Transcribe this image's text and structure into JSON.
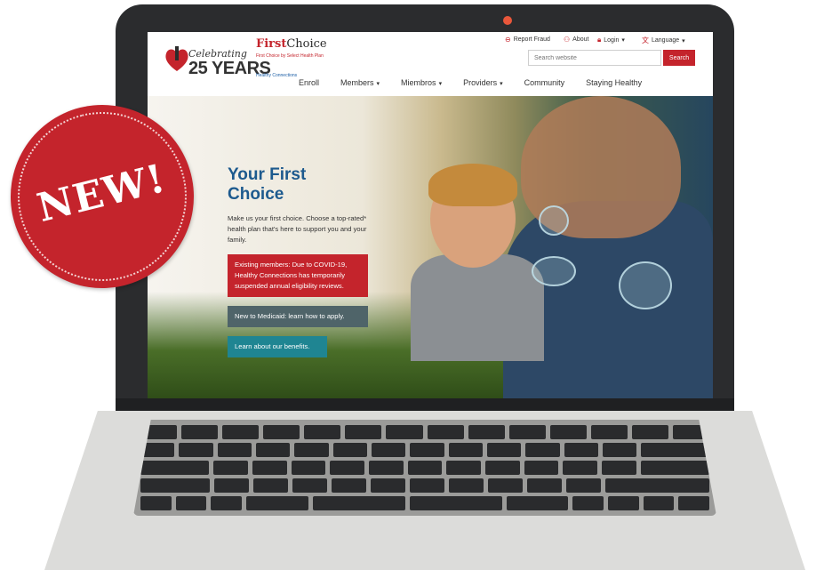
{
  "badge": {
    "text": "NEW!"
  },
  "site": {
    "logo": {
      "celebrating": "Celebrating",
      "years": "25 YEARS",
      "brand_first": "First",
      "brand_choice": "Choice",
      "brand_tagline": "First Choice by Select Health Plan",
      "partner": "Healthy Connections"
    },
    "utility": {
      "report_fraud": "Report Fraud",
      "about": "About",
      "login": "Login",
      "language": "Language"
    },
    "search": {
      "placeholder": "Search website",
      "button": "Search"
    },
    "nav": [
      {
        "label": "Enroll"
      },
      {
        "label": "Members"
      },
      {
        "label": "Miembros"
      },
      {
        "label": "Providers"
      },
      {
        "label": "Community"
      },
      {
        "label": "Staying Healthy"
      }
    ],
    "hero": {
      "title_part1": "Your ",
      "title_part2": "First",
      "title_part3": "Choice",
      "description": "Make us your first choice. Choose a top-rated* health plan that's here to support you and your family.",
      "covid_notice": "Existing members: Due to COVID-19, Healthy Connections has temporarily suspended annual eligibility reviews.",
      "medicaid_link": "New to Medicaid: learn how to apply.",
      "benefits_link": "Learn about our benefits."
    }
  },
  "colors": {
    "brand_red": "#c4242c",
    "brand_blue": "#1d5a8e",
    "slate": "#4f6469",
    "teal": "#1f8592"
  }
}
